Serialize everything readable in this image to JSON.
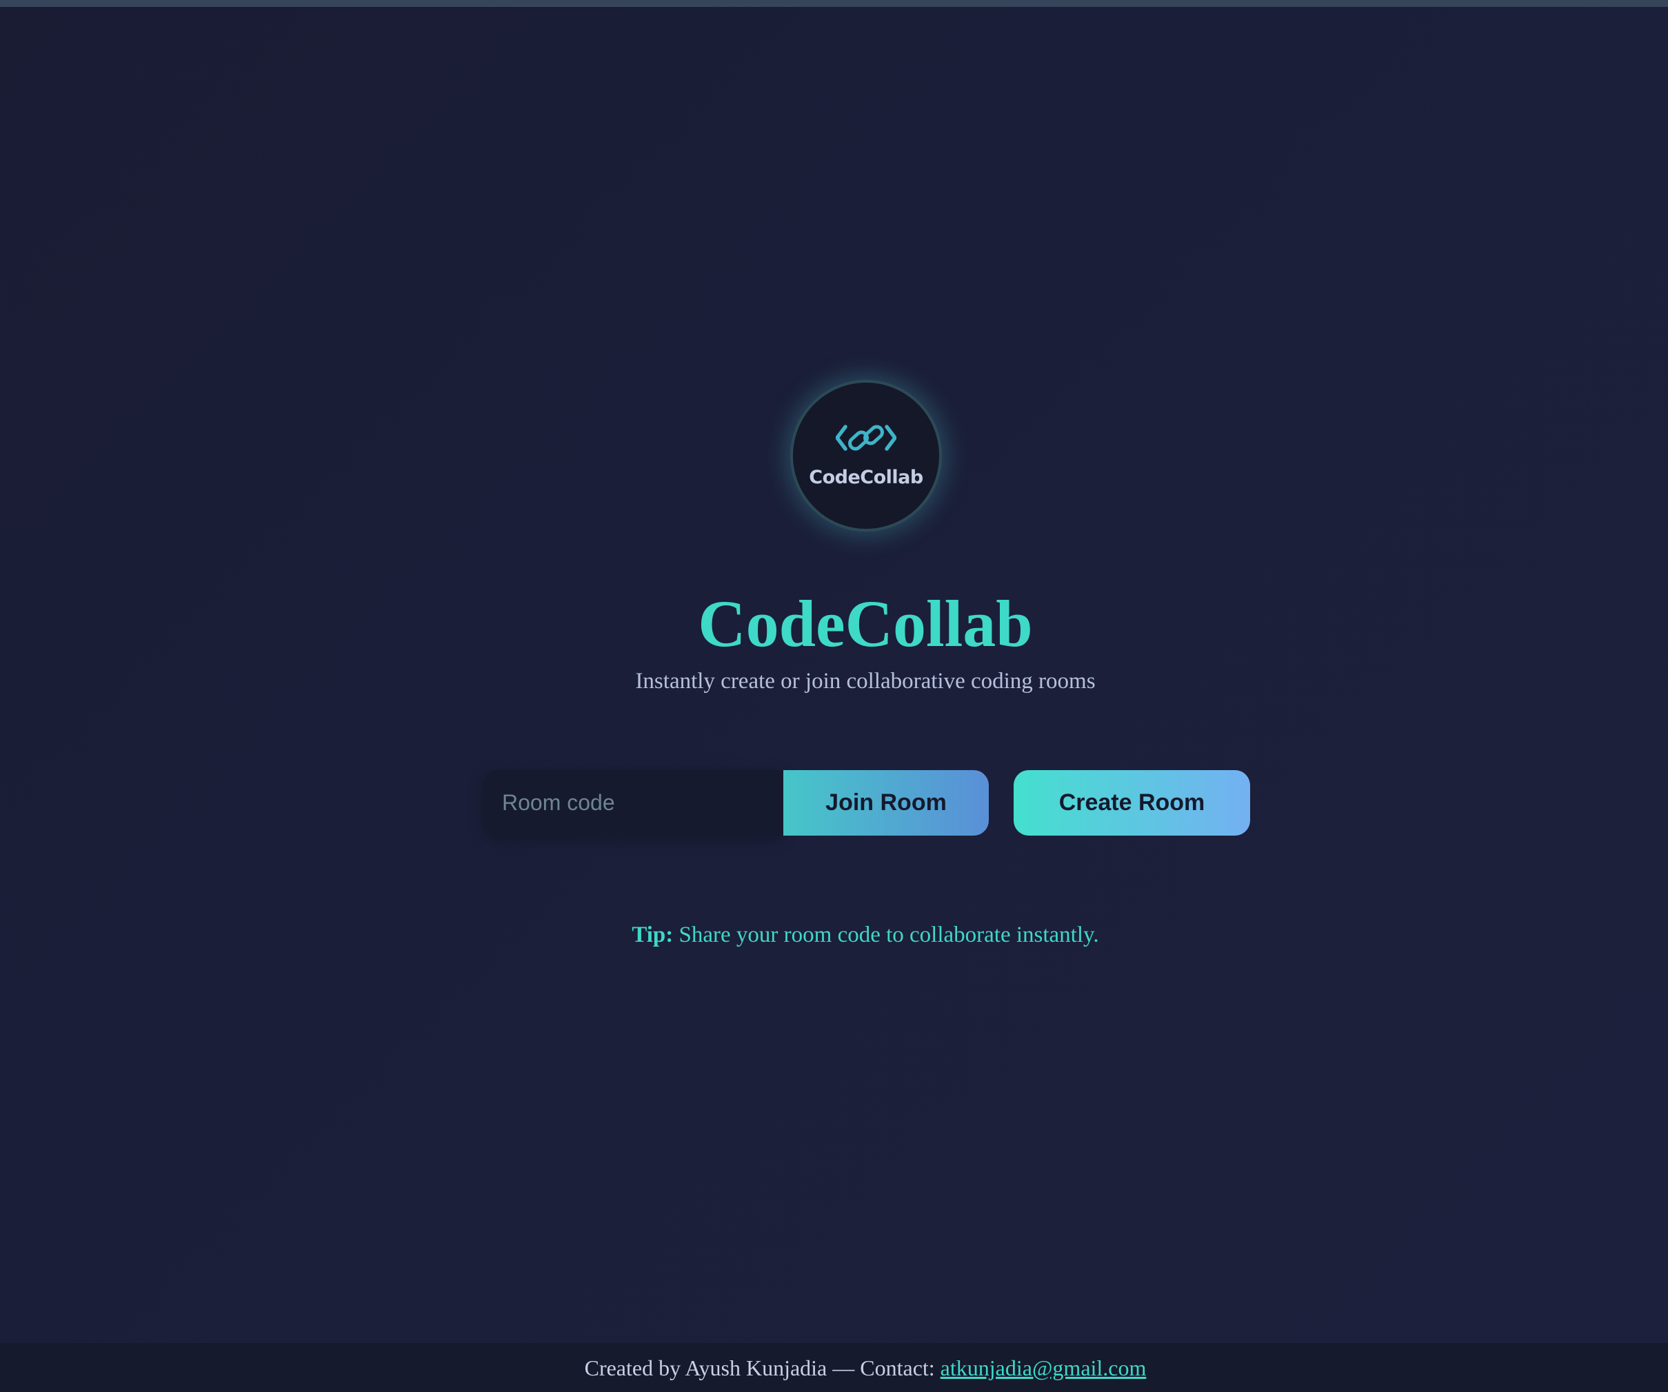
{
  "app": {
    "logo_text": "CodeCollab",
    "title": "CodeCollab",
    "subtitle": "Instantly create or join collaborative coding rooms"
  },
  "room_form": {
    "room_code_placeholder": "Room code",
    "room_code_value": "",
    "join_button_label": "Join Room",
    "create_button_label": "Create Room"
  },
  "tip": {
    "label": "Tip:",
    "text": " Share your room code to collaborate instantly."
  },
  "footer": {
    "text": "Created by Ayush Kunjadia — Contact: ",
    "email": "atkunjadia@gmail.com"
  },
  "icons": {
    "logo": "code-link-icon"
  },
  "colors": {
    "background": "#1b1f3a",
    "accent": "#3fd9c8",
    "logo_bg": "#151829",
    "subtitle": "#b6c0dc",
    "join_gradient_start": "#46c6c8",
    "join_gradient_end": "#5a8fd8",
    "create_gradient_start": "#44e0ce",
    "create_gradient_end": "#74b0f2",
    "footer_bg": "#161a2d"
  }
}
